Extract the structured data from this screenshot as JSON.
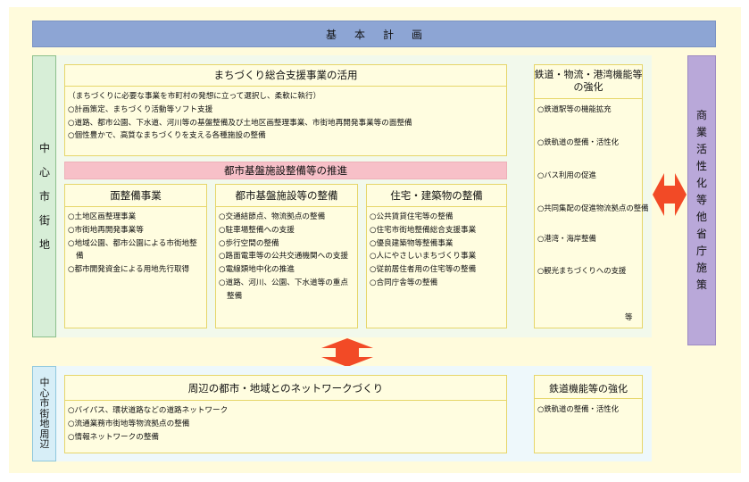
{
  "kihon_keikaku": "基本計画",
  "center_label": [
    "中",
    "心",
    "市",
    "街",
    "地"
  ],
  "support": {
    "title": "まちづくり総合支援事業の活用",
    "intro": "（まちづくりに必要な事業を市町村の発想に立って選択し、柔軟に執行）",
    "items": [
      "○計画策定、まちづくり活動等ソフト支援",
      "○道路、都市公園、下水道、河川等の基盤整備及び土地区画整理事業、市街地再開発事業等の面整備",
      "○個性豊かで、高質なまちづくりを支える各種施設の整備"
    ]
  },
  "pink_title": "都市基盤施設整備等の推進",
  "col1": {
    "title": "面整備事業",
    "items": [
      "○土地区画整理事業",
      "○市街地再開発事業等",
      "○地域公園、都市公園による市街地整備",
      "○都市開発資金による用地先行取得"
    ]
  },
  "col2": {
    "title": "都市基盤施設等の整備",
    "items": [
      "○交通結節点、物流拠点の整備",
      "○駐車場整備への支援",
      "○歩行空間の整備",
      "○路面電車等の公共交通機関への支援",
      "○電線類地中化の推進",
      "○道路、河川、公園、下水道等の重点整備"
    ]
  },
  "col3": {
    "title": "住宅・建築物の整備",
    "items": [
      "○公共賃貸住宅等の整備",
      "○住宅市街地整備総合支援事業",
      "○優良建築物等整備事業",
      "○人にやさしいまちづくり事業",
      "○従前居住者用の住宅等の整備",
      "○合同庁舎等の整備"
    ]
  },
  "rail": {
    "title": "鉄道・物流・港湾機能等の強化",
    "items": [
      "○鉄道駅等の機能拡充",
      "○鉄軌道の整備・活性化",
      "○バス利用の促進",
      "○共同集配の促進物流拠点の整備",
      "○港湾・海岸整備",
      "○観光まちづくりへの支援"
    ],
    "etc": "等"
  },
  "side_label": [
    "商",
    "業",
    "活",
    "性",
    "化",
    "等",
    "他",
    "省",
    "庁",
    "施",
    "策"
  ],
  "peri_label": [
    "中",
    "心",
    "市",
    "街",
    "地",
    "周",
    "辺"
  ],
  "network": {
    "title": "周辺の都市・地域とのネットワークづくり",
    "items": [
      "○バイパス、環状道路などの道路ネットワーク",
      "○流通業務市街地等物流拠点の整備",
      "○情報ネットワークの整備"
    ]
  },
  "rail2": {
    "title": "鉄道機能等の強化",
    "items": [
      "○鉄軌道の整備・活性化"
    ]
  },
  "colors": {
    "background": "#fffbdc",
    "kihon": "#8da5d4",
    "center": "#d7eed7",
    "side": "#b9a8d9",
    "periphery": "#d7eef7",
    "pink": "#f7c0c8",
    "arrow": "#f24a26"
  },
  "icons": {
    "horizontal_arrow": "double-arrow-left-right",
    "vertical_arrow": "double-arrow-up-down"
  }
}
